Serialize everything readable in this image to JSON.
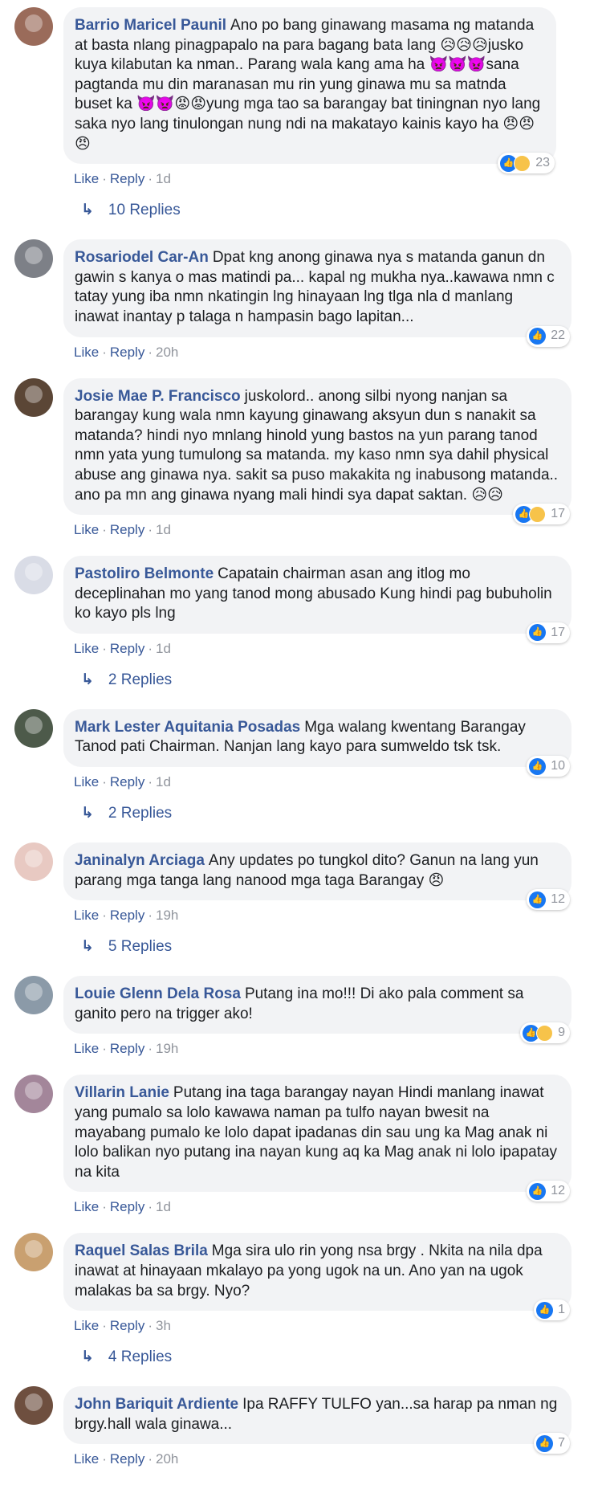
{
  "comments": [
    {
      "name": "Barrio Maricel Paunil",
      "text": "Ano po bang ginawang masama ng matanda at basta nlang pinagpapalo na para bagang bata lang 😥😥😥jusko kuya kilabutan ka nman.. Parang wala kang ama ha 👿👿👿sana pagtanda mu din maranasan mu rin yung ginawa mu sa matnda buset ka 👿👿😡😡yung mga tao sa barangay bat tiningnan nyo lang saka nyo lang tinulongan nung ndi na makatayo kainis kayo ha 😠😠😠",
      "like": "Like",
      "reply": "Reply",
      "time": "1d",
      "reactions": "23",
      "sad_reaction": true,
      "replies": "10 Replies",
      "avatar_color": "#9a6b5a"
    },
    {
      "name": "Rosariodel Car-An",
      "text": "Dpat kng anong ginawa nya s matanda ganun dn gawin s kanya o mas matindi pa... kapal ng mukha nya..kawawa nmn c tatay yung iba nmn nkatingin lng hinayaan lng tlga nla d manlang inawat inantay p talaga n hampasin bago lapitan...",
      "like": "Like",
      "reply": "Reply",
      "time": "20h",
      "reactions": "22",
      "sad_reaction": false,
      "replies": "",
      "avatar_color": "#7d8087"
    },
    {
      "name": "Josie Mae P. Francisco",
      "text": "juskolord.. anong silbi nyong nanjan sa barangay kung wala nmn kayung ginawang aksyun dun s nanakit sa matanda? hindi nyo mnlang hinold yung bastos na yun parang tanod nmn yata yung tumulong sa matanda. my kaso nmn sya dahil physical abuse ang ginawa nya. sakit sa puso makakita ng inabusong matanda.. ano pa mn ang ginawa nyang mali hindi sya dapat saktan. 😥😥",
      "like": "Like",
      "reply": "Reply",
      "time": "1d",
      "reactions": "17",
      "sad_reaction": true,
      "replies": "",
      "avatar_color": "#5b4636"
    },
    {
      "name": "Pastoliro Belmonte",
      "text": "Capatain chairman asan ang itlog mo deceplinahan mo yang tanod mong abusado Kung hindi pag bubuholin ko kayo pls lng",
      "like": "Like",
      "reply": "Reply",
      "time": "1d",
      "reactions": "17",
      "sad_reaction": false,
      "replies": "2 Replies",
      "avatar_color": "#d9dce6"
    },
    {
      "name": "Mark Lester Aquitania Posadas",
      "text": "Mga walang kwentang Barangay Tanod pati Chairman. Nanjan lang kayo para sumweldo tsk tsk.",
      "like": "Like",
      "reply": "Reply",
      "time": "1d",
      "reactions": "10",
      "sad_reaction": false,
      "replies": "2 Replies",
      "avatar_color": "#4d5a4a"
    },
    {
      "name": "Janinalyn Arciaga",
      "text": "Any updates po tungkol dito? Ganun na lang yun parang mga tanga lang nanood mga taga Barangay 😠",
      "like": "Like",
      "reply": "Reply",
      "time": "19h",
      "reactions": "12",
      "sad_reaction": false,
      "replies": "5 Replies",
      "avatar_color": "#e8c9c2"
    },
    {
      "name": "Louie Glenn Dela Rosa",
      "text": "Putang ina mo!!! Di ako pala comment sa ganito pero na trigger ako!",
      "like": "Like",
      "reply": "Reply",
      "time": "19h",
      "reactions": "9",
      "sad_reaction": true,
      "replies": "",
      "avatar_color": "#8b9aa8"
    },
    {
      "name": "Villarin Lanie",
      "text": "Putang ina taga barangay nayan Hindi manlang inawat yang pumalo sa lolo kawawa naman pa tulfo nayan bwesit na mayabang pumalo ke lolo dapat ipadanas din sau ung ka Mag anak ni lolo balikan nyo putang ina nayan kung aq ka Mag anak ni lolo ipapatay na kita",
      "like": "Like",
      "reply": "Reply",
      "time": "1d",
      "reactions": "12",
      "sad_reaction": false,
      "replies": "",
      "avatar_color": "#a3869a"
    },
    {
      "name": "Raquel Salas Brila",
      "text": "Mga sira ulo rin yong nsa brgy . Nkita na nila dpa inawat at hinayaan mkalayo pa yong ugok na un. Ano yan na ugok malakas ba sa brgy. Nyo?",
      "like": "Like",
      "reply": "Reply",
      "time": "3h",
      "reactions": "1",
      "sad_reaction": false,
      "replies": "4 Replies",
      "avatar_color": "#c9a070"
    },
    {
      "name": "John Bariquit Ardiente",
      "text": "Ipa RAFFY TULFO yan...sa harap pa nman ng brgy.hall wala ginawa...",
      "like": "Like",
      "reply": "Reply",
      "time": "20h",
      "reactions": "7",
      "sad_reaction": false,
      "replies": "",
      "avatar_color": "#6e4f3f"
    }
  ]
}
